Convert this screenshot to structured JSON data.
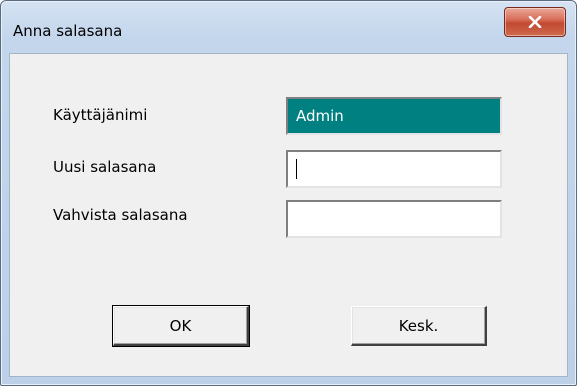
{
  "window": {
    "title": "Anna salasana"
  },
  "close_icon": "close-icon",
  "form": {
    "username_label": "Käyttäjänimi",
    "username_value": "Admin",
    "new_password_label": "Uusi salasana",
    "new_password_value": "",
    "confirm_password_label": "Vahvista salasana",
    "confirm_password_value": ""
  },
  "buttons": {
    "ok_label": "OK",
    "cancel_label": "Kesk."
  },
  "colors": {
    "readonly_field_bg": "#008080",
    "close_button": "#c24a32"
  }
}
